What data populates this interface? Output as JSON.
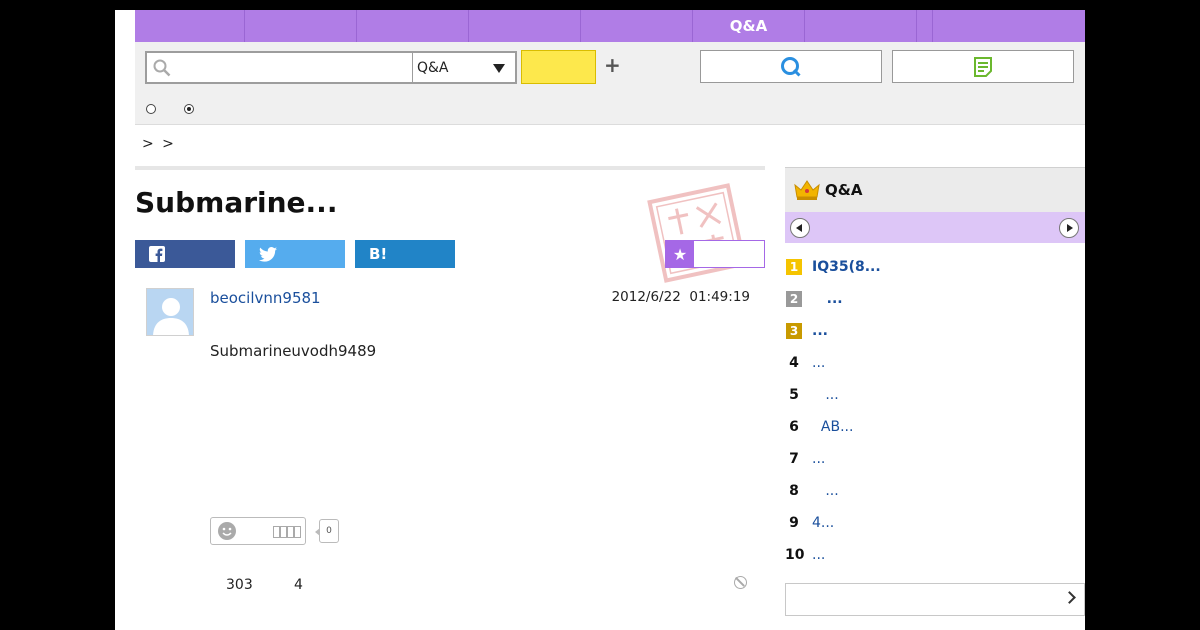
{
  "nav": {
    "items": [
      "",
      "",
      "",
      "",
      "",
      "Q&A",
      "",
      "",
      ""
    ]
  },
  "search": {
    "value": "",
    "placeholder": "",
    "scope": "Q&A",
    "button_label": "",
    "question_label": "",
    "answer_label": "",
    "radio_selected_index": 1
  },
  "breadcrumb": "> >",
  "question": {
    "title": "Submarine...",
    "username": "beocilvnn9581",
    "date": "2012/6/22  01:49:19",
    "body": "Submarineuvodh9489",
    "reaction_label": "",
    "reaction_count": "0",
    "views": "303",
    "answers": "4"
  },
  "share": {
    "facebook_icon": "f",
    "twitter_icon": "twitter-bird",
    "hatena_label": "B!"
  },
  "sidebar": {
    "title": "Q&A",
    "ranking": [
      {
        "rank": "1",
        "title": "IQ35(8...",
        "badge_color": "#f5c400",
        "bold": true
      },
      {
        "rank": "2",
        "title": "   ...",
        "badge_color": "#999999",
        "bold": true
      },
      {
        "rank": "3",
        "title": "...",
        "badge_color": "#c89a00",
        "bold": true
      },
      {
        "rank": "4",
        "title": "...",
        "badge_color": "",
        "bold": false
      },
      {
        "rank": "5",
        "title": "   ...",
        "badge_color": "",
        "bold": false
      },
      {
        "rank": "6",
        "title": "  AB...",
        "badge_color": "",
        "bold": false
      },
      {
        "rank": "7",
        "title": "...",
        "badge_color": "",
        "bold": false
      },
      {
        "rank": "8",
        "title": "   ...",
        "badge_color": "",
        "bold": false
      },
      {
        "rank": "9",
        "title": "4...",
        "badge_color": "",
        "bold": false
      },
      {
        "rank": "10",
        "title": "...",
        "badge_color": "",
        "bold": false
      }
    ],
    "more_label": ""
  },
  "colors": {
    "nav": "#b07de6",
    "accent": "#a568e6",
    "link": "#1a4f9c",
    "search_button": "#fde84c"
  }
}
